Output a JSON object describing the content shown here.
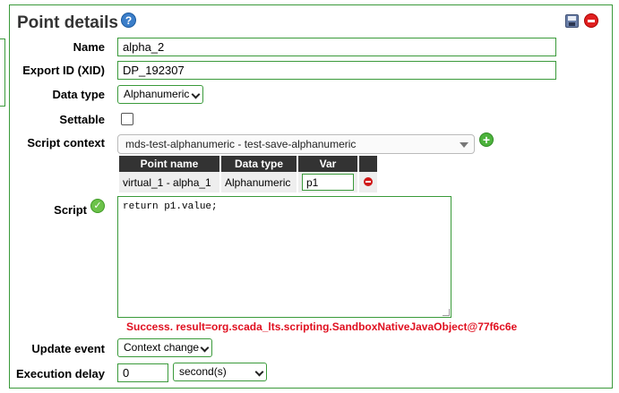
{
  "panel": {
    "title": "Point details",
    "help_icon": "help-icon",
    "save_icon": "save-icon",
    "delete_icon": "delete-icon"
  },
  "fields": {
    "name_label": "Name",
    "name_value": "alpha_2",
    "xid_label": "Export ID (XID)",
    "xid_value": "DP_192307",
    "data_type_label": "Data type",
    "data_type_value": "Alphanumeric",
    "settable_label": "Settable",
    "settable_checked": false,
    "script_context_label": "Script context",
    "script_context_value": "mds-test-alphanumeric - test-save-alphanumeric",
    "script_label": "Script",
    "script_value": "return p1.value;",
    "update_event_label": "Update event",
    "update_event_value": "Context change",
    "execution_delay_label": "Execution delay",
    "execution_delay_value": "0",
    "execution_delay_unit": "second(s)"
  },
  "context_table": {
    "headers": [
      "Point name",
      "Data type",
      "Var"
    ],
    "rows": [
      {
        "point_name": "virtual_1 - alpha_1",
        "data_type": "Alphanumeric",
        "var": "p1"
      }
    ]
  },
  "status_message": "Success. result=org.scada_lts.scripting.SandboxNativeJavaObject@77f6c6e",
  "colors": {
    "border": "#3a9a3a",
    "header_bg": "#333333",
    "status": "#e01020"
  }
}
